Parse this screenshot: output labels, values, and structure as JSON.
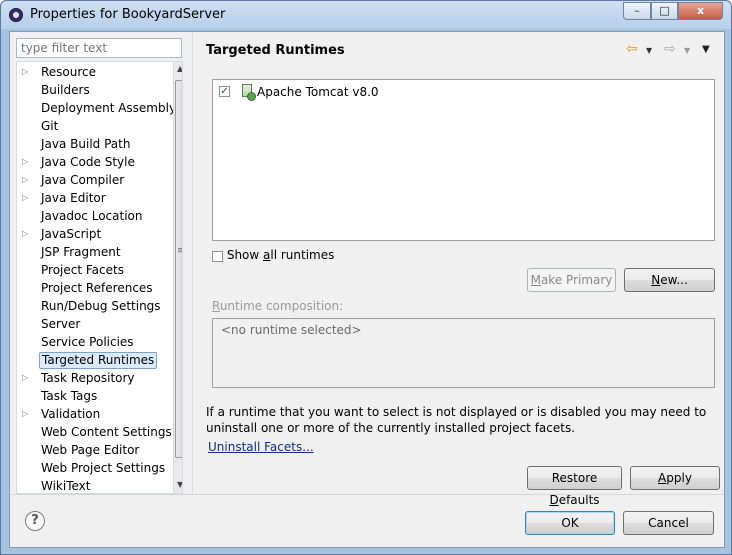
{
  "window": {
    "title": "Properties for BookyardServer",
    "controls": {
      "minimize": "–",
      "maximize": "□",
      "close": "x"
    }
  },
  "filter": {
    "placeholder": "type filter text"
  },
  "tree": {
    "items": [
      {
        "label": "Resource",
        "expandable": true
      },
      {
        "label": "Builders",
        "expandable": false
      },
      {
        "label": "Deployment Assembly",
        "expandable": false
      },
      {
        "label": "Git",
        "expandable": false
      },
      {
        "label": "Java Build Path",
        "expandable": false
      },
      {
        "label": "Java Code Style",
        "expandable": true
      },
      {
        "label": "Java Compiler",
        "expandable": true
      },
      {
        "label": "Java Editor",
        "expandable": true
      },
      {
        "label": "Javadoc Location",
        "expandable": false
      },
      {
        "label": "JavaScript",
        "expandable": true
      },
      {
        "label": "JSP Fragment",
        "expandable": false
      },
      {
        "label": "Project Facets",
        "expandable": false
      },
      {
        "label": "Project References",
        "expandable": false
      },
      {
        "label": "Run/Debug Settings",
        "expandable": false
      },
      {
        "label": "Server",
        "expandable": false
      },
      {
        "label": "Service Policies",
        "expandable": false
      },
      {
        "label": "Targeted Runtimes",
        "expandable": false,
        "selected": true
      },
      {
        "label": "Task Repository",
        "expandable": true
      },
      {
        "label": "Task Tags",
        "expandable": false
      },
      {
        "label": "Validation",
        "expandable": true
      },
      {
        "label": "Web Content Settings",
        "expandable": false
      },
      {
        "label": "Web Page Editor",
        "expandable": false
      },
      {
        "label": "Web Project Settings",
        "expandable": false
      },
      {
        "label": "WikiText",
        "expandable": false
      }
    ]
  },
  "page": {
    "title": "Targeted Runtimes",
    "nav": {
      "back": "⇦",
      "forward": "⇨",
      "dropdown": "▼",
      "menu": "▼"
    }
  },
  "runtimes": [
    {
      "label": "Apache Tomcat v8.0",
      "checked": true,
      "check_glyph": "✓"
    }
  ],
  "show_all": {
    "pre": "Show ",
    "mnemonic": "a",
    "post": "ll runtimes",
    "checked": false
  },
  "buttons": {
    "make_primary": {
      "mnemonic": "M",
      "rest": "ake Primary"
    },
    "new": {
      "mnemonic": "N",
      "rest": "ew..."
    },
    "restore_defaults": {
      "pre": "Restore ",
      "mnemonic": "D",
      "rest": "efaults"
    },
    "apply": {
      "mnemonic": "A",
      "rest": "pply"
    },
    "ok": "OK",
    "cancel": "Cancel"
  },
  "composition": {
    "label_mnemonic": "R",
    "label_rest": "untime composition:",
    "empty_text": "<no runtime selected>"
  },
  "info_text": "If a runtime that you want to select is not displayed or is disabled you may need to uninstall one or more of the currently installed project facets.",
  "uninstall_link": "Uninstall Facets...",
  "help": "?",
  "icons": {
    "expand": "▷",
    "scroll_up": "▲",
    "scroll_down": "▼",
    "grip": "≡"
  }
}
